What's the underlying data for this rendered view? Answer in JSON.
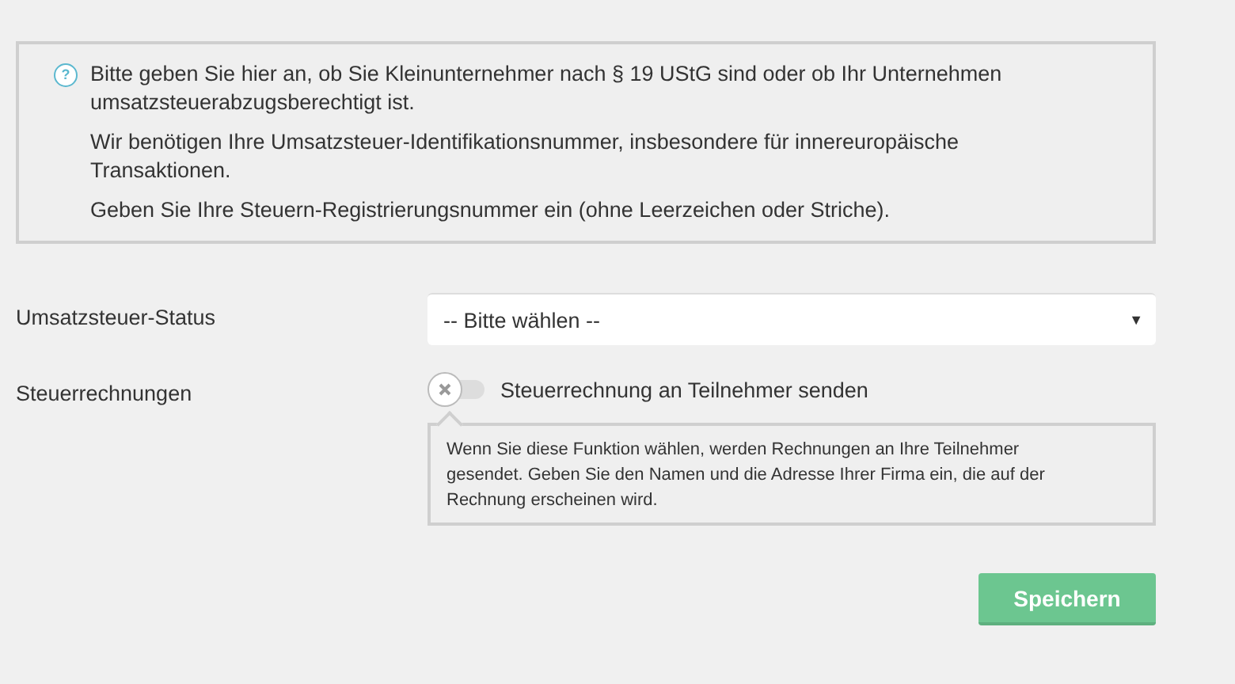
{
  "info": {
    "icon": "?",
    "paragraphs": [
      "Bitte geben Sie hier an, ob Sie Kleinunternehmer nach § 19 UStG sind oder ob Ihr Unternehmen umsatzsteuerabzugsberechtigt ist.",
      "Wir benötigen Ihre Umsatzsteuer-Identifikationsnummer, insbesondere für innereuropäische Transaktionen.",
      "Geben Sie Ihre Steuern-Registrierungsnummer ein (ohne Leerzeichen oder Striche)."
    ]
  },
  "fields": [
    {
      "kind": "select",
      "label": "Umsatzsteuer-Status",
      "value": "-- Bitte wählen --",
      "caret": "▼"
    },
    {
      "kind": "toggle",
      "label": "Steuerrechnungen",
      "text": "Steuerrechnung an Teilnehmer senden",
      "on": false,
      "help": "Wenn Sie diese Funktion wählen, werden Rechnungen an Ihre Teilnehmer gesendet. Geben Sie den Namen und die Adresse Ihrer Firma ein, die auf der Rechnung erscheinen wird."
    }
  ],
  "save_button": "Speichern"
}
